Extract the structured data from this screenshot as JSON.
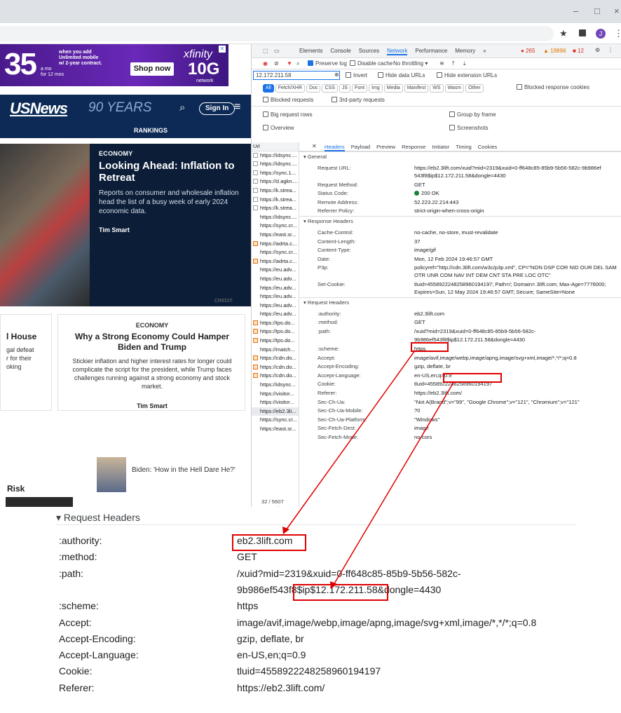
{
  "window": {
    "minimize": "–",
    "maximize": "□",
    "close": "×"
  },
  "toolbar": {
    "star": "★",
    "menu": "⋮",
    "avatar": "J"
  },
  "ad": {
    "big": "35",
    "small_top": "when you add\nUnlimited mobile\nw/ 2-year contract.",
    "small_per": "a mo\nfor 12 mos",
    "shop": "Shop now",
    "brand": "xfinity",
    "tenG": "10G",
    "network": "network"
  },
  "site": {
    "logo": "USNews",
    "yrs": "90 YEARS",
    "signin": "Sign In",
    "nav": "RANKINGS"
  },
  "story": {
    "kicker": "ECONOMY",
    "title": "Looking Ahead: Inflation to Retreat",
    "desc": "Reports on consumer and wholesale inflation head the list of a busy week of early 2024 economic data.",
    "author": "Tim Smart",
    "credit": "CREDIT"
  },
  "card1": {
    "title": "l House",
    "desc": "gal defeat\nr for their\noking"
  },
  "card2": {
    "kicker": "ECONOMY",
    "title": "Why a Strong Economy Could Hamper Biden and Trump",
    "desc": "Stickier inflation and higher interest rates for longer could complicate the script for the president, while Trump faces challenges running against a strong economy and stock market.",
    "author": "Tim Smart"
  },
  "bottom": {
    "risk": "Risk",
    "biden": "Biden: 'How in the Hell Dare He?'"
  },
  "devtools": {
    "tabs": [
      "Elements",
      "Console",
      "Sources",
      "Network",
      "Performance",
      "Memory",
      "»"
    ],
    "active_tab": "Network",
    "errors": "265",
    "warnings": "19896",
    "issues": "12",
    "preserve_log": "Preserve log",
    "disable_cache": "Disable cache",
    "throttle": "No throttling",
    "filter_value": "12.172.211.58",
    "invert": "Invert",
    "hide_data": "Hide data URLs",
    "hide_ext": "Hide extension URLs",
    "types": [
      "All",
      "Fetch/XHR",
      "Doc",
      "CSS",
      "JS",
      "Font",
      "Img",
      "Media",
      "Manifest",
      "WS",
      "Wasm",
      "Other"
    ],
    "blocked_cookies": "Blocked response cookies",
    "blocked_req": "Blocked requests",
    "third_party": "3rd-party requests",
    "big_rows": "Big request rows",
    "group_frame": "Group by frame",
    "overview": "Overview",
    "screenshots": "Screenshots",
    "url_header": "Url",
    "urls": [
      {
        "t": "https://idsync....",
        "i": "doc"
      },
      {
        "t": "https://idsync....",
        "i": "doc"
      },
      {
        "t": "https://sync.1...",
        "i": "doc"
      },
      {
        "t": "https://d.agkn....",
        "i": "doc"
      },
      {
        "t": "https://k.strea...",
        "i": "doc"
      },
      {
        "t": "https://k.strea...",
        "i": "doc"
      },
      {
        "t": "https://k.strea...",
        "i": "doc"
      },
      {
        "t": "https://idsync....",
        "i": ""
      },
      {
        "t": "https://sync.cr...",
        "i": ""
      },
      {
        "t": "https://east.sr...",
        "i": ""
      },
      {
        "t": "https://adrta.c...",
        "i": "img"
      },
      {
        "t": "https://sync.cr...",
        "i": ""
      },
      {
        "t": "https://adrta.c...",
        "i": "img"
      },
      {
        "t": "https://eu.adv...",
        "i": ""
      },
      {
        "t": "https://eu.adv...",
        "i": ""
      },
      {
        "t": "https://eu.adv...",
        "i": ""
      },
      {
        "t": "https://eu.adv...",
        "i": ""
      },
      {
        "t": "https://eu.adv...",
        "i": ""
      },
      {
        "t": "https://eu.adv...",
        "i": ""
      },
      {
        "t": "https://tps.do...",
        "i": "img"
      },
      {
        "t": "https://tps.do...",
        "i": "img"
      },
      {
        "t": "https://tps.do...",
        "i": "img"
      },
      {
        "t": "https://match...",
        "i": ""
      },
      {
        "t": "https://cdn.do...",
        "i": "img"
      },
      {
        "t": "https://cdn.do...",
        "i": "img"
      },
      {
        "t": "https://cdn.do...",
        "i": "img"
      },
      {
        "t": "https://idsync...",
        "i": ""
      },
      {
        "t": "https://visitor...",
        "i": ""
      },
      {
        "t": "https://visitor...",
        "i": ""
      },
      {
        "t": "https://eb2.3li...",
        "i": "",
        "sel": true
      },
      {
        "t": "https://sync.cr...",
        "i": ""
      },
      {
        "t": "https://east.sr...",
        "i": ""
      }
    ],
    "status": "32 / 5607 requests",
    "detail_tabs": [
      "Headers",
      "Payload",
      "Preview",
      "Response",
      "Initiator",
      "Timing",
      "Cookies"
    ],
    "general_title": "General",
    "general": [
      {
        "k": "Request URL:",
        "v": "https://eb2.3lift.com/xuid?mid=2319&xuid=0-ff648c85-85b9-5b56-582c-9b986ef 543f8$ip$12.172.211.58&dongle=4430"
      },
      {
        "k": "Request Method:",
        "v": "GET"
      },
      {
        "k": "Status Code:",
        "v": "200 OK"
      },
      {
        "k": "Remote Address:",
        "v": "52.223.22.214:443"
      },
      {
        "k": "Referrer Policy:",
        "v": "strict-origin-when-cross-origin"
      }
    ],
    "resp_title": "Response Headers",
    "resp": [
      {
        "k": "Cache-Control:",
        "v": "no-cache, no-store, must-revalidate"
      },
      {
        "k": "Content-Length:",
        "v": "37"
      },
      {
        "k": "Content-Type:",
        "v": "image/gif"
      },
      {
        "k": "Date:",
        "v": "Mon, 12 Feb 2024 19:46:57 GMT"
      },
      {
        "k": "P3p:",
        "v": "policyref=\"http://cdn.3lift.com/w3c/p3p.xml\", CP=\"NON DSP COR NID OUR DEL SAM OTR UNR COM NAV INT DEM CNT STA PRE LOC OTC\""
      },
      {
        "k": "Set-Cookie:",
        "v": "tluid=4558922248258960194197; Path=/; Domain=.3lift.com; Max-Age=7776000; Expires=Sun, 12 May 2024 19:46:57 GMT; Secure; SameSite=None"
      }
    ],
    "req_title": "Request Headers",
    "req": [
      {
        "k": ":authority:",
        "v": "eb2.3lift.com"
      },
      {
        "k": ":method:",
        "v": "GET"
      },
      {
        "k": ":path:",
        "v": "/xuid?mid=2319&xuid=0-ff648c85-85b9-5b56-582c-"
      },
      {
        "k": "",
        "v": "9b986ef543f8$ip$12.172.211.58&dongle=4430"
      },
      {
        "k": ":scheme:",
        "v": "https"
      },
      {
        "k": "Accept:",
        "v": "image/avif,image/webp,image/apng,image/svg+xml,image/*,*/*;q=0.8"
      },
      {
        "k": "Accept-Encoding:",
        "v": "gzip, deflate, br"
      },
      {
        "k": "Accept-Language:",
        "v": "en-US,en;q=0.9"
      },
      {
        "k": "Cookie:",
        "v": "tluid=4558922248258960194197"
      },
      {
        "k": "Referer:",
        "v": "https://eb2.3lift.com/"
      },
      {
        "k": "Sec-Ch-Ua:",
        "v": "\"Not A(Brand\";v=\"99\", \"Google Chrome\";v=\"121\", \"Chromium\";v=\"121\""
      },
      {
        "k": "Sec-Ch-Ua-Mobile:",
        "v": "?0"
      },
      {
        "k": "Sec-Ch-Ua-Platform:",
        "v": "\"Windows\""
      },
      {
        "k": "Sec-Fetch-Dest:",
        "v": "image"
      },
      {
        "k": "Sec-Fetch-Mode:",
        "v": "no-cors"
      }
    ]
  },
  "zoom": {
    "section": "Request Headers",
    "rows": [
      {
        "k": ":authority:",
        "v": "eb2.3lift.com"
      },
      {
        "k": ":method:",
        "v": "GET"
      },
      {
        "k": ":path:",
        "v": "/xuid?mid=2319&xuid=0-ff648c85-85b9-5b56-582c-"
      },
      {
        "k": "",
        "v": "9b986ef543f8$ip$12.172.211.58&dongle=4430"
      },
      {
        "k": ":scheme:",
        "v": "https"
      },
      {
        "k": "Accept:",
        "v": "image/avif,image/webp,image/apng,image/svg+xml,image/*,*/*;q=0.8"
      },
      {
        "k": "Accept-Encoding:",
        "v": "gzip, deflate, br"
      },
      {
        "k": "Accept-Language:",
        "v": "en-US,en;q=0.9"
      },
      {
        "k": "Cookie:",
        "v": "tluid=4558922248258960194197"
      },
      {
        "k": "Referer:",
        "v": "https://eb2.3lift.com/"
      }
    ]
  },
  "colors": {
    "highlight": "#e00000",
    "accent": "#1a73e8",
    "navy": "#0c2a55"
  }
}
